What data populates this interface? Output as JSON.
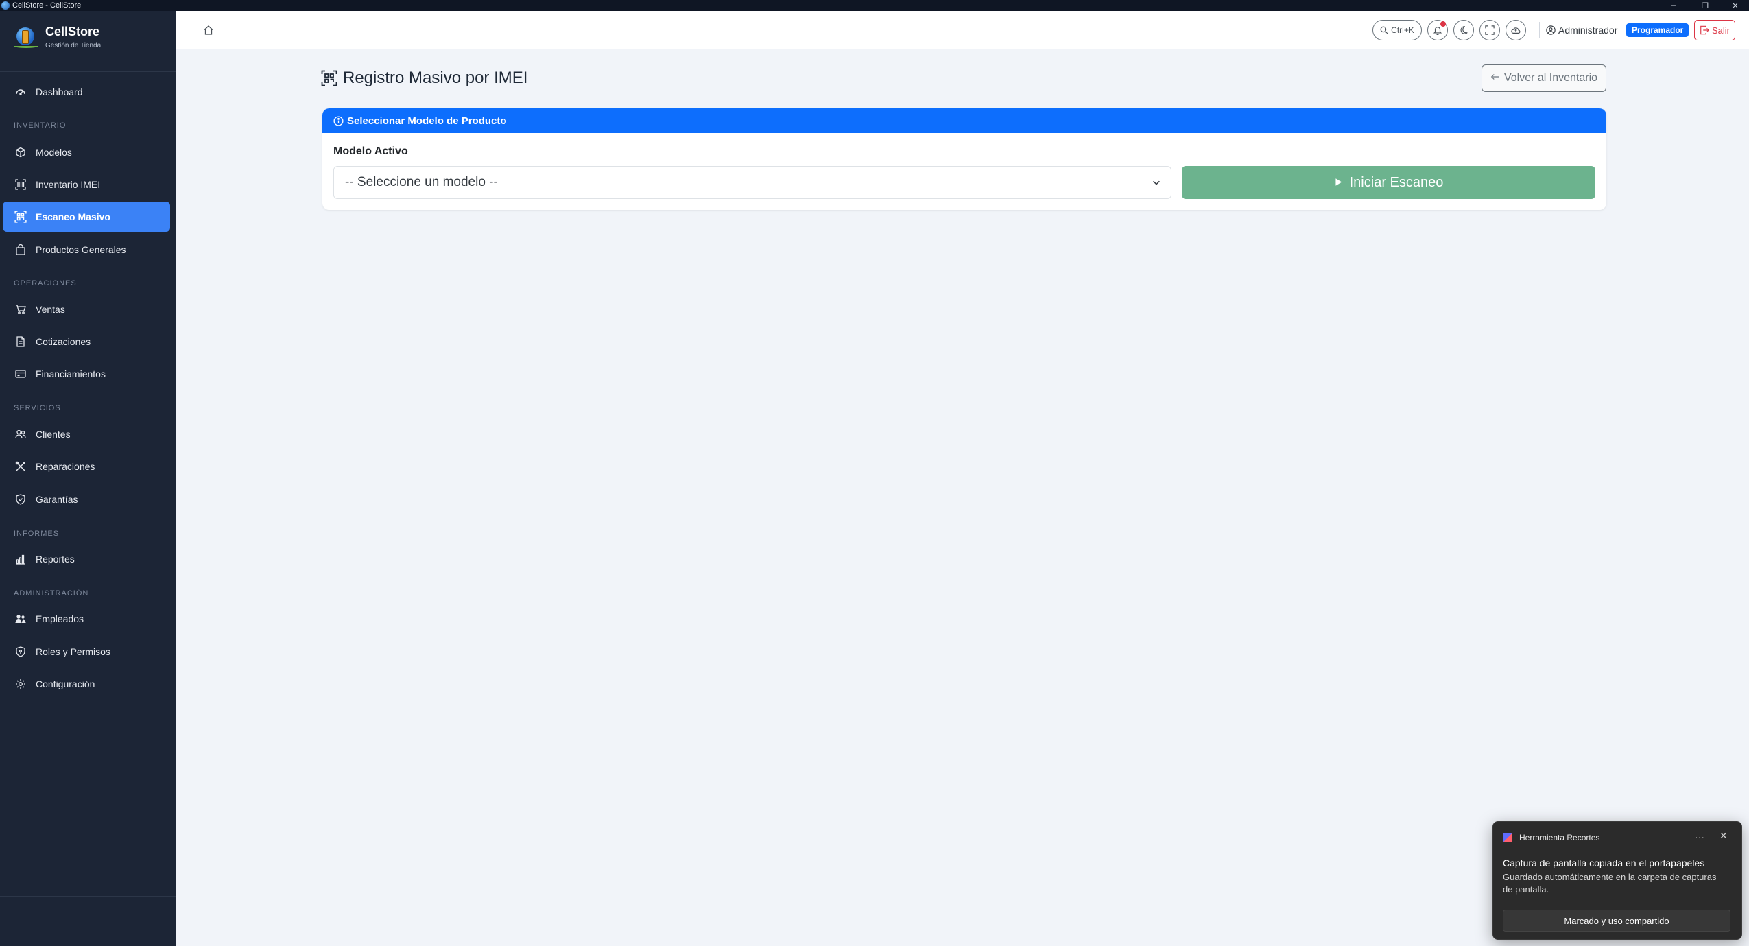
{
  "window": {
    "title": "CellStore - CellStore",
    "minimize_glyph": "–",
    "restore_glyph": "❐",
    "close_glyph": "✕"
  },
  "brand": {
    "name": "CellStore",
    "tagline": "Gestión de Tienda"
  },
  "sidebar": {
    "dashboard": {
      "label": "Dashboard",
      "icon": "gauge-icon"
    },
    "sections": {
      "inventario": "INVENTARIO",
      "operaciones": "OPERACIONES",
      "servicios": "SERVICIOS",
      "informes": "INFORMES",
      "administracion": "ADMINISTRACIÓN"
    },
    "items": {
      "modelos": {
        "label": "Modelos",
        "icon": "box-icon"
      },
      "inventario_imei": {
        "label": "Inventario IMEI",
        "icon": "barcode-scan-icon"
      },
      "escaneo_masivo": {
        "label": "Escaneo Masivo",
        "icon": "qr-scan-icon",
        "active": true
      },
      "productos_generales": {
        "label": "Productos Generales",
        "icon": "bag-icon"
      },
      "ventas": {
        "label": "Ventas",
        "icon": "cart-icon"
      },
      "cotizaciones": {
        "label": "Cotizaciones",
        "icon": "document-icon"
      },
      "financiamientos": {
        "label": "Financiamientos",
        "icon": "credit-card-icon"
      },
      "clientes": {
        "label": "Clientes",
        "icon": "users-icon"
      },
      "reparaciones": {
        "label": "Reparaciones",
        "icon": "tools-icon"
      },
      "garantias": {
        "label": "Garantías",
        "icon": "shield-check-icon"
      },
      "reportes": {
        "label": "Reportes",
        "icon": "bar-chart-icon"
      },
      "empleados": {
        "label": "Empleados",
        "icon": "people-fill-icon"
      },
      "roles": {
        "label": "Roles y Permisos",
        "icon": "shield-lock-icon"
      },
      "configuracion": {
        "label": "Configuración",
        "icon": "gear-icon"
      }
    }
  },
  "topbar": {
    "search_shortcut": "Ctrl+K",
    "user_name": "Administrador",
    "role_badge": "Programador",
    "logout_label": "Salir"
  },
  "page": {
    "title": "Registro Masivo por IMEI",
    "back_button": "Volver al Inventario"
  },
  "card": {
    "header": "Seleccionar Modelo de Producto",
    "field_label": "Modelo Activo",
    "select_value": "-- Seleccione un modelo --",
    "start_button": "Iniciar Escaneo"
  },
  "toast": {
    "app_name": "Herramienta Recortes",
    "more_glyph": "···",
    "close_glyph": "✕",
    "title": "Captura de pantalla copiada en el portapapeles",
    "body": "Guardado automáticamente en la carpeta de capturas de pantalla.",
    "button": "Marcado y uso compartido"
  },
  "colors": {
    "sidebar_bg": "#1c2536",
    "active_item": "#3b82f6",
    "primary": "#0d6efd",
    "start_button": "#6cb38e",
    "danger": "#dc3545",
    "content_bg": "#f1f4f9"
  }
}
